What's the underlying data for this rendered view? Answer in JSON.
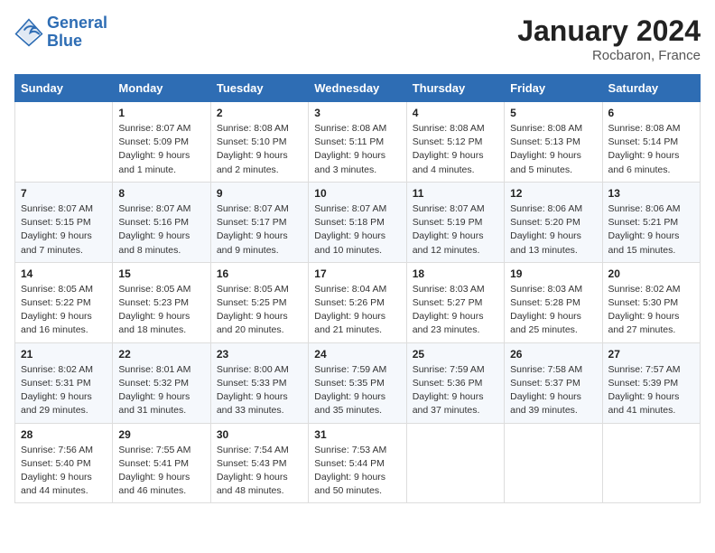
{
  "header": {
    "logo_line1": "General",
    "logo_line2": "Blue",
    "month": "January 2024",
    "location": "Rocbaron, France"
  },
  "weekdays": [
    "Sunday",
    "Monday",
    "Tuesday",
    "Wednesday",
    "Thursday",
    "Friday",
    "Saturday"
  ],
  "weeks": [
    [
      {
        "day": "",
        "sunrise": "",
        "sunset": "",
        "daylight": ""
      },
      {
        "day": "1",
        "sunrise": "Sunrise: 8:07 AM",
        "sunset": "Sunset: 5:09 PM",
        "daylight": "Daylight: 9 hours and 1 minute."
      },
      {
        "day": "2",
        "sunrise": "Sunrise: 8:08 AM",
        "sunset": "Sunset: 5:10 PM",
        "daylight": "Daylight: 9 hours and 2 minutes."
      },
      {
        "day": "3",
        "sunrise": "Sunrise: 8:08 AM",
        "sunset": "Sunset: 5:11 PM",
        "daylight": "Daylight: 9 hours and 3 minutes."
      },
      {
        "day": "4",
        "sunrise": "Sunrise: 8:08 AM",
        "sunset": "Sunset: 5:12 PM",
        "daylight": "Daylight: 9 hours and 4 minutes."
      },
      {
        "day": "5",
        "sunrise": "Sunrise: 8:08 AM",
        "sunset": "Sunset: 5:13 PM",
        "daylight": "Daylight: 9 hours and 5 minutes."
      },
      {
        "day": "6",
        "sunrise": "Sunrise: 8:08 AM",
        "sunset": "Sunset: 5:14 PM",
        "daylight": "Daylight: 9 hours and 6 minutes."
      }
    ],
    [
      {
        "day": "7",
        "sunrise": "Sunrise: 8:07 AM",
        "sunset": "Sunset: 5:15 PM",
        "daylight": "Daylight: 9 hours and 7 minutes."
      },
      {
        "day": "8",
        "sunrise": "Sunrise: 8:07 AM",
        "sunset": "Sunset: 5:16 PM",
        "daylight": "Daylight: 9 hours and 8 minutes."
      },
      {
        "day": "9",
        "sunrise": "Sunrise: 8:07 AM",
        "sunset": "Sunset: 5:17 PM",
        "daylight": "Daylight: 9 hours and 9 minutes."
      },
      {
        "day": "10",
        "sunrise": "Sunrise: 8:07 AM",
        "sunset": "Sunset: 5:18 PM",
        "daylight": "Daylight: 9 hours and 10 minutes."
      },
      {
        "day": "11",
        "sunrise": "Sunrise: 8:07 AM",
        "sunset": "Sunset: 5:19 PM",
        "daylight": "Daylight: 9 hours and 12 minutes."
      },
      {
        "day": "12",
        "sunrise": "Sunrise: 8:06 AM",
        "sunset": "Sunset: 5:20 PM",
        "daylight": "Daylight: 9 hours and 13 minutes."
      },
      {
        "day": "13",
        "sunrise": "Sunrise: 8:06 AM",
        "sunset": "Sunset: 5:21 PM",
        "daylight": "Daylight: 9 hours and 15 minutes."
      }
    ],
    [
      {
        "day": "14",
        "sunrise": "Sunrise: 8:05 AM",
        "sunset": "Sunset: 5:22 PM",
        "daylight": "Daylight: 9 hours and 16 minutes."
      },
      {
        "day": "15",
        "sunrise": "Sunrise: 8:05 AM",
        "sunset": "Sunset: 5:23 PM",
        "daylight": "Daylight: 9 hours and 18 minutes."
      },
      {
        "day": "16",
        "sunrise": "Sunrise: 8:05 AM",
        "sunset": "Sunset: 5:25 PM",
        "daylight": "Daylight: 9 hours and 20 minutes."
      },
      {
        "day": "17",
        "sunrise": "Sunrise: 8:04 AM",
        "sunset": "Sunset: 5:26 PM",
        "daylight": "Daylight: 9 hours and 21 minutes."
      },
      {
        "day": "18",
        "sunrise": "Sunrise: 8:03 AM",
        "sunset": "Sunset: 5:27 PM",
        "daylight": "Daylight: 9 hours and 23 minutes."
      },
      {
        "day": "19",
        "sunrise": "Sunrise: 8:03 AM",
        "sunset": "Sunset: 5:28 PM",
        "daylight": "Daylight: 9 hours and 25 minutes."
      },
      {
        "day": "20",
        "sunrise": "Sunrise: 8:02 AM",
        "sunset": "Sunset: 5:30 PM",
        "daylight": "Daylight: 9 hours and 27 minutes."
      }
    ],
    [
      {
        "day": "21",
        "sunrise": "Sunrise: 8:02 AM",
        "sunset": "Sunset: 5:31 PM",
        "daylight": "Daylight: 9 hours and 29 minutes."
      },
      {
        "day": "22",
        "sunrise": "Sunrise: 8:01 AM",
        "sunset": "Sunset: 5:32 PM",
        "daylight": "Daylight: 9 hours and 31 minutes."
      },
      {
        "day": "23",
        "sunrise": "Sunrise: 8:00 AM",
        "sunset": "Sunset: 5:33 PM",
        "daylight": "Daylight: 9 hours and 33 minutes."
      },
      {
        "day": "24",
        "sunrise": "Sunrise: 7:59 AM",
        "sunset": "Sunset: 5:35 PM",
        "daylight": "Daylight: 9 hours and 35 minutes."
      },
      {
        "day": "25",
        "sunrise": "Sunrise: 7:59 AM",
        "sunset": "Sunset: 5:36 PM",
        "daylight": "Daylight: 9 hours and 37 minutes."
      },
      {
        "day": "26",
        "sunrise": "Sunrise: 7:58 AM",
        "sunset": "Sunset: 5:37 PM",
        "daylight": "Daylight: 9 hours and 39 minutes."
      },
      {
        "day": "27",
        "sunrise": "Sunrise: 7:57 AM",
        "sunset": "Sunset: 5:39 PM",
        "daylight": "Daylight: 9 hours and 41 minutes."
      }
    ],
    [
      {
        "day": "28",
        "sunrise": "Sunrise: 7:56 AM",
        "sunset": "Sunset: 5:40 PM",
        "daylight": "Daylight: 9 hours and 44 minutes."
      },
      {
        "day": "29",
        "sunrise": "Sunrise: 7:55 AM",
        "sunset": "Sunset: 5:41 PM",
        "daylight": "Daylight: 9 hours and 46 minutes."
      },
      {
        "day": "30",
        "sunrise": "Sunrise: 7:54 AM",
        "sunset": "Sunset: 5:43 PM",
        "daylight": "Daylight: 9 hours and 48 minutes."
      },
      {
        "day": "31",
        "sunrise": "Sunrise: 7:53 AM",
        "sunset": "Sunset: 5:44 PM",
        "daylight": "Daylight: 9 hours and 50 minutes."
      },
      {
        "day": "",
        "sunrise": "",
        "sunset": "",
        "daylight": ""
      },
      {
        "day": "",
        "sunrise": "",
        "sunset": "",
        "daylight": ""
      },
      {
        "day": "",
        "sunrise": "",
        "sunset": "",
        "daylight": ""
      }
    ]
  ]
}
